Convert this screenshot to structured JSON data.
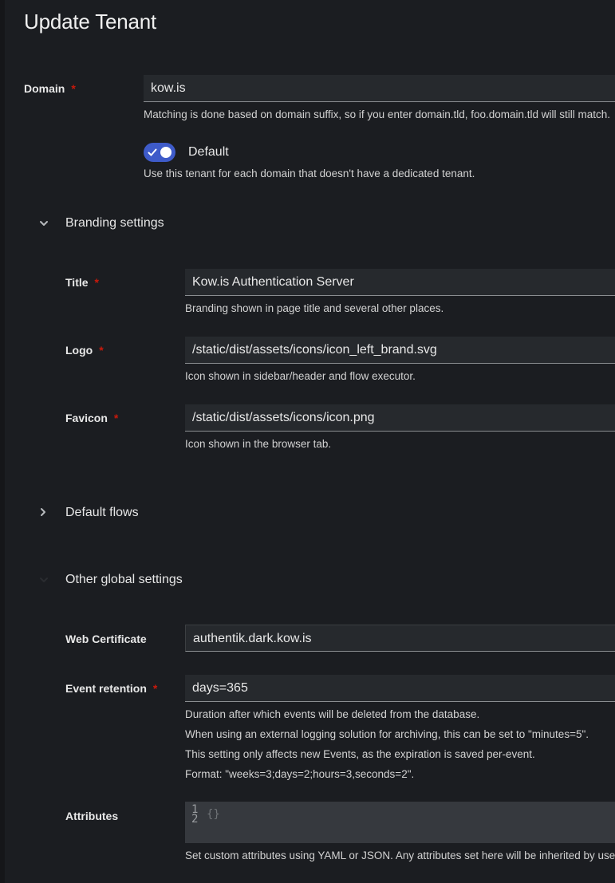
{
  "modal": {
    "title": "Update Tenant"
  },
  "domain": {
    "label": "Domain",
    "required_marker": "*",
    "value": "kow.is",
    "help": "Matching is done based on domain suffix, so if you enter domain.tld, foo.domain.tld will still match."
  },
  "default_toggle": {
    "label": "Default",
    "checked": true,
    "help": "Use this tenant for each domain that doesn't have a dedicated tenant."
  },
  "branding": {
    "section_label": "Branding settings",
    "expanded": true,
    "title": {
      "label": "Title",
      "required_marker": "*",
      "value": "Kow.is Authentication Server",
      "help": "Branding shown in page title and several other places."
    },
    "logo": {
      "label": "Logo",
      "required_marker": "*",
      "value": "/static/dist/assets/icons/icon_left_brand.svg",
      "help": "Icon shown in sidebar/header and flow executor."
    },
    "favicon": {
      "label": "Favicon",
      "required_marker": "*",
      "value": "/static/dist/assets/icons/icon.png",
      "help": "Icon shown in the browser tab."
    }
  },
  "default_flows": {
    "section_label": "Default flows",
    "expanded": false
  },
  "other_settings": {
    "section_label": "Other global settings",
    "expanded": true,
    "web_certificate": {
      "label": "Web Certificate",
      "value": "authentik.dark.kow.is"
    },
    "event_retention": {
      "label": "Event retention",
      "required_marker": "*",
      "value": "days=365",
      "help_lines": [
        "Duration after which events will be deleted from the database.",
        "When using an external logging solution for archiving, this can be set to \"minutes=5\".",
        "This setting only affects new Events, as the expiration is saved per-event.",
        "Format: \"weeks=3;days=2;hours=3,seconds=2\"."
      ]
    },
    "attributes": {
      "label": "Attributes",
      "line_numbers": [
        "1",
        "2"
      ],
      "code": "{}",
      "help": "Set custom attributes using YAML or JSON. Any attributes set here will be inherited by users, if the request is handled by this tenant."
    }
  },
  "colors": {
    "background": "#1b1d21",
    "input_background": "#26292d",
    "accent": "#3e5bc9",
    "required": "#c9190b"
  }
}
